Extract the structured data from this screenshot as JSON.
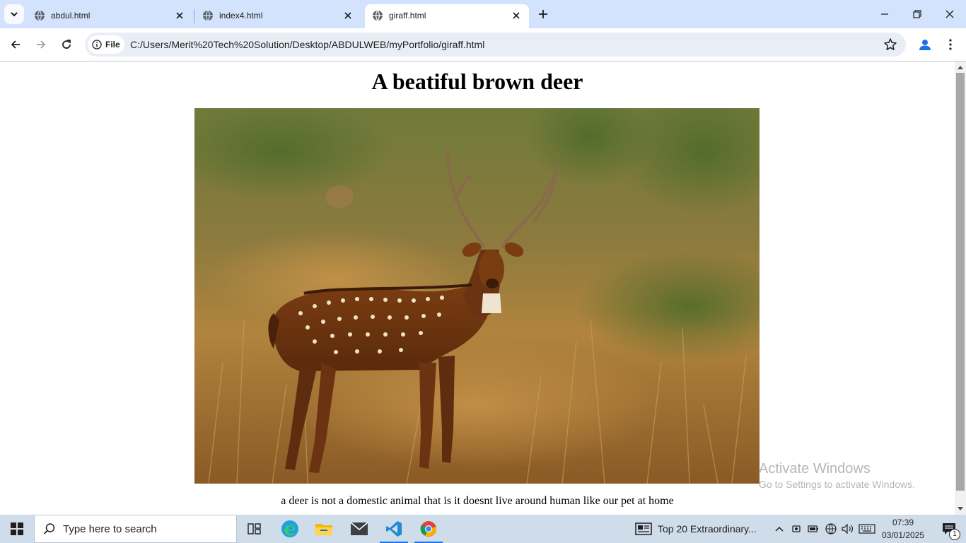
{
  "browser": {
    "tabs": [
      {
        "title": "abdul.html",
        "active": false
      },
      {
        "title": "index4.html",
        "active": false
      },
      {
        "title": "giraff.html",
        "active": true
      }
    ],
    "site_chip_label": "File",
    "url": "C:/Users/Merit%20Tech%20Solution/Desktop/ABDULWEB/myPortfolio/giraff.html"
  },
  "page": {
    "heading": "A beatiful brown deer",
    "image_subject": "spotted deer stag standing in dry grass",
    "caption": "a deer is not a domestic animal that is it doesnt live around human like our pet at home"
  },
  "watermark": {
    "line1": "Activate Windows",
    "line2": "Go to Settings to activate Windows."
  },
  "taskbar": {
    "search_placeholder": "Type here to search",
    "apps": [
      "task-view",
      "edge",
      "file-explorer",
      "mail",
      "vscode",
      "chrome"
    ],
    "news_text": "Top 20 Extraordinary...",
    "time": "07:39",
    "date": "03/01/2025",
    "notification_count": "1"
  },
  "colors": {
    "tabstrip_bg": "#d3e3fd",
    "omnibox_bg": "#e9eef6",
    "taskbar_bg": "#cfdcea",
    "accent": "#1a73e8"
  }
}
